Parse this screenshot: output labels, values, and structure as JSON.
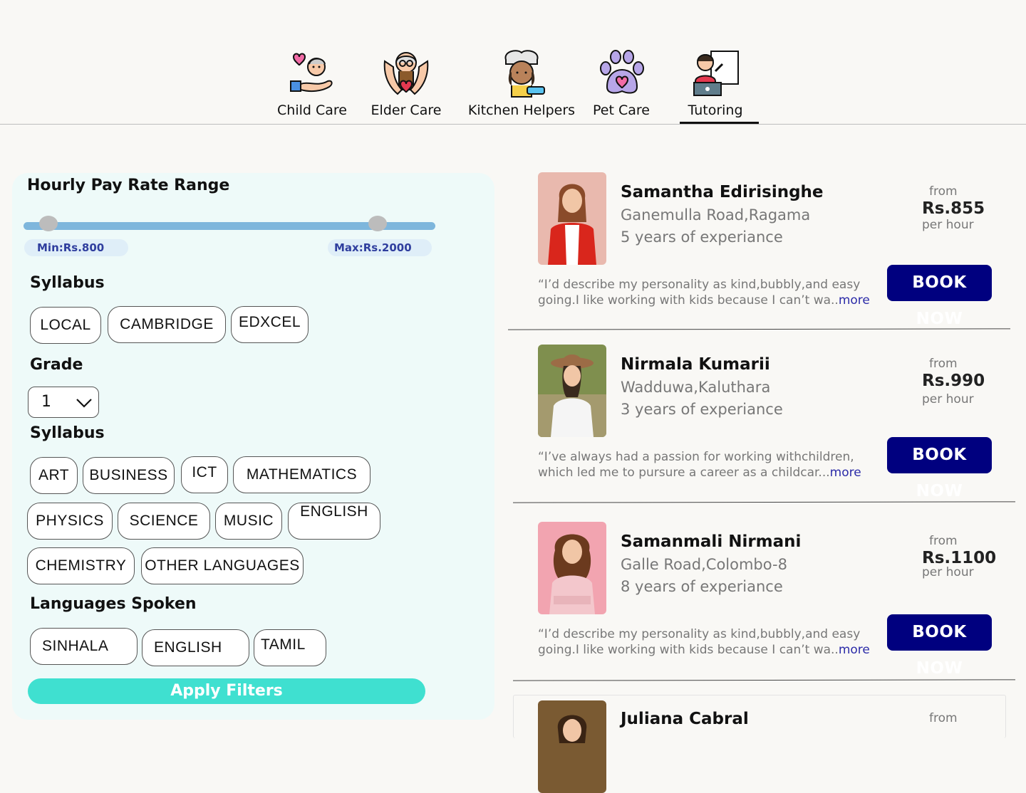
{
  "nav": {
    "items": [
      {
        "label": "Child Care",
        "icon": "child-care-icon"
      },
      {
        "label": "Elder Care",
        "icon": "elder-care-icon"
      },
      {
        "label": "Kitchen Helpers",
        "icon": "kitchen-helper-icon"
      },
      {
        "label": "Pet Care",
        "icon": "pet-care-icon"
      },
      {
        "label": "Tutoring",
        "icon": "tutoring-icon"
      }
    ],
    "active": "Tutoring"
  },
  "filters": {
    "pay_title": "Hourly Pay Rate Range",
    "min_label": "Min:Rs.800",
    "max_label": "Max:Rs.2000",
    "slider_min_fraction": 0.06,
    "slider_max_fraction": 0.86,
    "syllabus_title": "Syllabus",
    "syllabus": [
      "LOCAL",
      "CAMBRIDGE",
      "EDXCEL"
    ],
    "grade_title": "Grade",
    "grade_value": "1",
    "subjects_title": "Syllabus",
    "subjects": [
      "ART",
      "BUSINESS",
      "ICT",
      "MATHEMATICS",
      "PHYSICS",
      "SCIENCE",
      "MUSIC",
      "ENGLISH",
      "CHEMISTRY",
      "OTHER LANGUAGES"
    ],
    "languages_title": "Languages Spoken",
    "languages": [
      "SINHALA",
      "ENGLISH",
      "TAMIL"
    ],
    "apply_label": "Apply Filters"
  },
  "colors": {
    "accent": "#3fe0d0",
    "book_button": "#00007f",
    "panel": "#eefaf9",
    "slider": "#7eb6dc"
  },
  "cards": [
    {
      "name": "Samantha Edirisinghe",
      "location": "Ganemulla Road,Ragama",
      "experience": "5 years of experiance",
      "from": "from",
      "price": "Rs.855",
      "per": "per hour",
      "quote": "“I’d describe my personality as kind,bubbly,and easy going.I like working with kids because I can’t wa..",
      "more": "more",
      "button": "BOOK NOW"
    },
    {
      "name": "Nirmala Kumarii",
      "location": "Wadduwa,Kaluthara",
      "experience": "3 years of experiance",
      "from": "from",
      "price": "Rs.990",
      "per": "per hour",
      "quote": "“I’ve always had a passion for working withchildren, which led me to pursure a career as a childcar...",
      "more": "more",
      "button": "BOOK NOW"
    },
    {
      "name": "Samanmali Nirmani",
      "location": "Galle Road,Colombo-8",
      "experience": "8 years of experiance",
      "from": "from",
      "price": "Rs.1100",
      "per": "per hour",
      "quote": "“I’d describe my personality as kind,bubbly,and easy going.I like working with kids because I can’t wa..",
      "more": "more",
      "button": "BOOK NOW"
    },
    {
      "name": "Juliana Cabral",
      "from": "from"
    }
  ]
}
